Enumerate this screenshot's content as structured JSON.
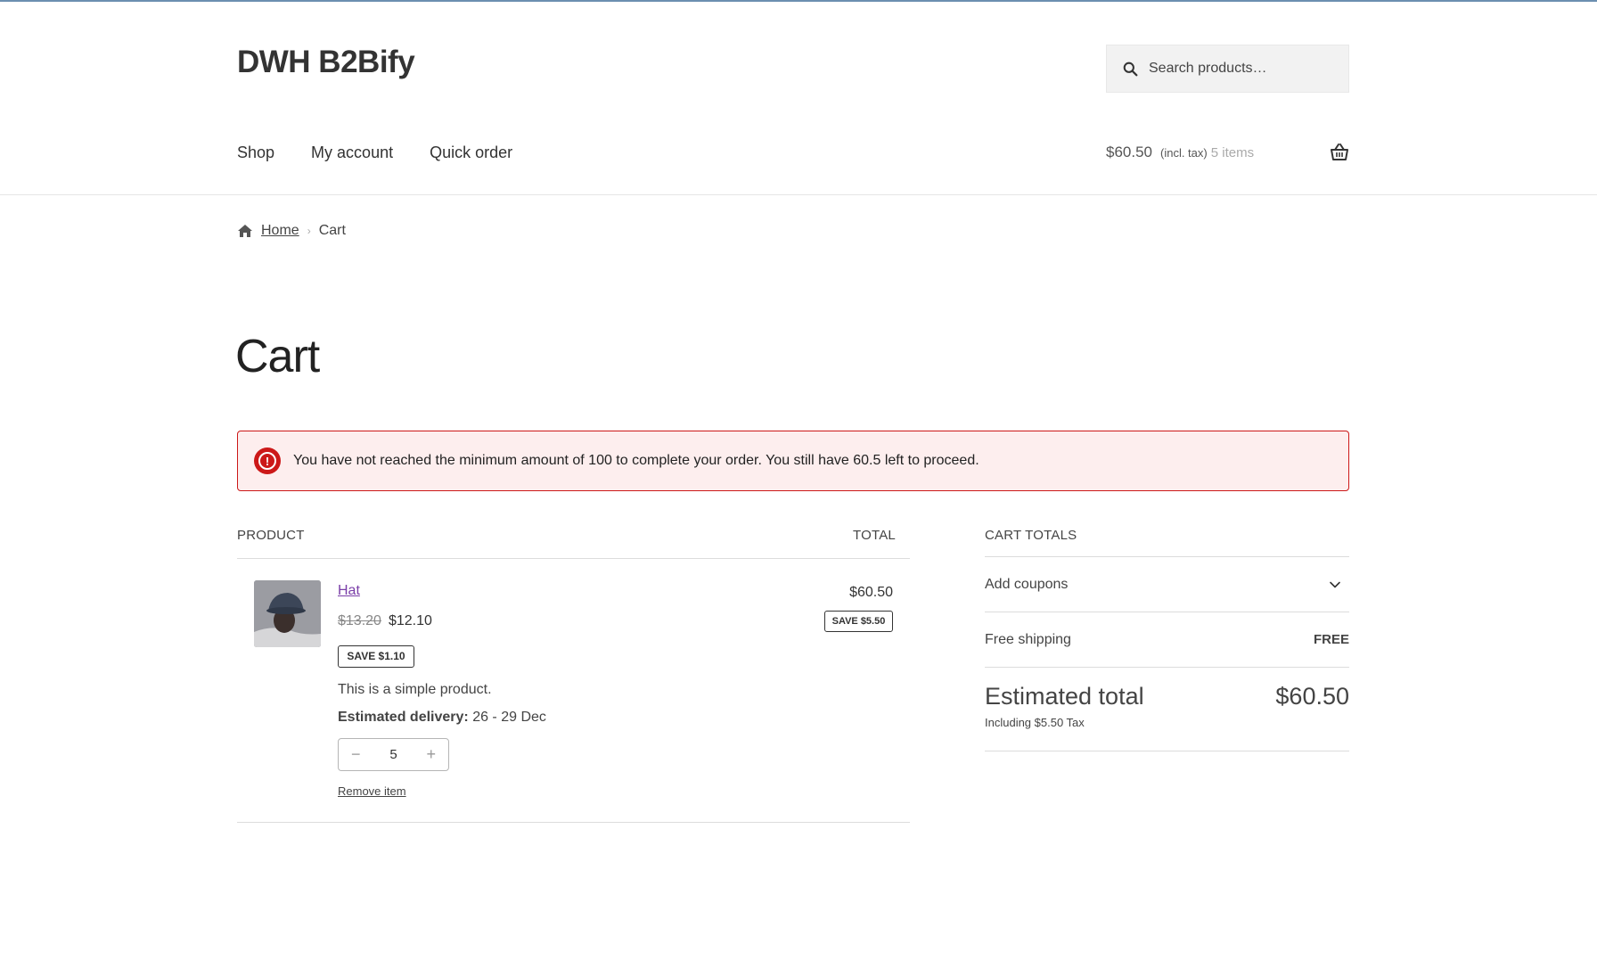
{
  "site": {
    "title": "DWH B2Bify"
  },
  "search": {
    "placeholder": "Search products…"
  },
  "nav": {
    "items": [
      "Shop",
      "My account",
      "Quick order"
    ]
  },
  "mini_cart": {
    "amount": "$60.50",
    "tax_note": "(incl. tax)",
    "items": "5 items"
  },
  "breadcrumb": {
    "home": "Home",
    "current": "Cart",
    "separator": "›"
  },
  "page": {
    "title": "Cart"
  },
  "notice": {
    "message": "You have not reached the minimum amount of 100 to complete your order. You still have 60.5 left to proceed.",
    "color": "#cc1818"
  },
  "cart_table": {
    "headers": {
      "product": "PRODUCT",
      "total": "TOTAL"
    },
    "item": {
      "name": "Hat",
      "regular_price": "$13.20",
      "sale_price": "$12.10",
      "save_badge": "SAVE $1.10",
      "description": "This is a simple product.",
      "delivery_label": "Estimated delivery:",
      "delivery_value": "26 - 29 Dec",
      "quantity": "5",
      "minus": "−",
      "plus": "+",
      "remove": "Remove item",
      "line_total": "$60.50",
      "line_save_badge": "SAVE $5.50"
    }
  },
  "totals": {
    "header": "CART TOTALS",
    "coupons": "Add coupons",
    "shipping_label": "Free shipping",
    "shipping_value": "FREE",
    "estimated_label": "Estimated total",
    "estimated_value": "$60.50",
    "tax_note": "Including $5.50 Tax"
  },
  "colors": {
    "link": "#7a3ea8",
    "error": "#cc1818",
    "notice_bg": "#fdeeee"
  }
}
